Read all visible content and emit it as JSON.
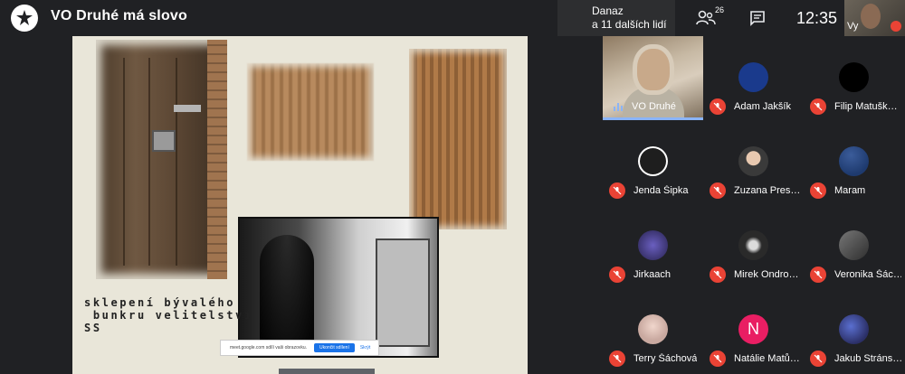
{
  "meeting": {
    "title": "VO Druhé má slovo"
  },
  "presenting": {
    "line1": "Danaz",
    "line2": "a 11 dalších lidí"
  },
  "toolbar": {
    "people_count": "26",
    "clock": "12:35"
  },
  "self_view": {
    "label": "Vy"
  },
  "slide": {
    "caption_lines": [
      "sklepení bývalého",
      " bunkru velitelství",
      "SS"
    ],
    "share_bar": {
      "text": "meet.google.com sdílí vaši obrazovku.",
      "stop_label": "Ukončit sdílení",
      "hide_label": "Skrýt"
    }
  },
  "participants": [
    {
      "name": "VO Druhé",
      "speaking": true
    },
    {
      "name": "Adam Jakšík",
      "avatar_color": "#1a3a8c"
    },
    {
      "name": "Filip Matušk…",
      "avatar_color": "#000000"
    },
    {
      "name": "Jenda Šipka",
      "avatar_color": "#1e1e1e"
    },
    {
      "name": "Zuzana Pres…",
      "avatar_color": "#3a3a3a"
    },
    {
      "name": "Maram",
      "avatar_color": "#1e3a6e"
    },
    {
      "name": "Jirkaach",
      "avatar_color": "#3b3470"
    },
    {
      "name": "Mirek Ondro…",
      "avatar_color": "#2a2a2a"
    },
    {
      "name": "Veronika Šác…",
      "avatar_color": "#4a4a4a"
    },
    {
      "name": "Terry Šáchová",
      "avatar_color": "#c9a9a0"
    },
    {
      "name": "Natálie Matů…",
      "avatar_letter": "N",
      "avatar_color": "#e91e63"
    },
    {
      "name": "Jakub Stráns…",
      "avatar_color": "#2b2f66"
    }
  ],
  "colors": {
    "background": "#202124",
    "mute_red": "#ea4335",
    "speaking_blue": "#8ab4f8"
  }
}
